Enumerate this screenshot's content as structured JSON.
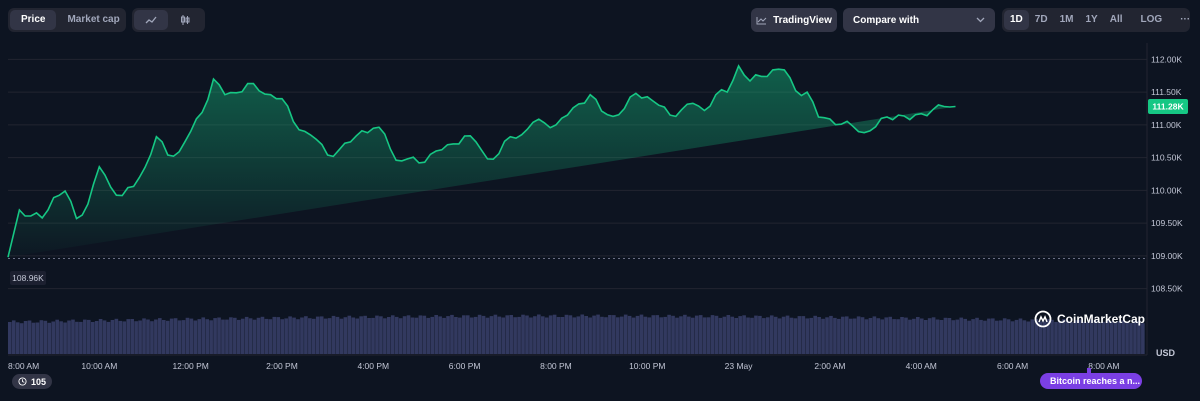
{
  "toolbar": {
    "view_tabs": [
      {
        "label": "Price",
        "active": true
      },
      {
        "label": "Market cap",
        "active": false
      }
    ],
    "chart_type_icons": [
      {
        "icon": "line-chart-icon",
        "active": true
      },
      {
        "icon": "candlestick-icon",
        "active": false
      }
    ],
    "tradingview_label": "TradingView",
    "compare_label": "Compare with",
    "ranges": [
      {
        "label": "1D",
        "active": true
      },
      {
        "label": "7D"
      },
      {
        "label": "1M"
      },
      {
        "label": "1Y"
      },
      {
        "label": "All"
      }
    ],
    "log_label": "LOG",
    "more_label": "···"
  },
  "brand": "CoinMarketCap",
  "events_count": "105",
  "news_pill": "Bitcoin reaches a n...",
  "colors": {
    "background": "#0d1421",
    "line": "#16c784",
    "volume": "#3a3f6a",
    "price_badge": "#16c784"
  },
  "chart_data": {
    "type": "area",
    "ylim": [
      108250,
      112250
    ],
    "y_ticks": [
      "112.00K",
      "111.50K",
      "111.00K",
      "110.50K",
      "110.00K",
      "109.50K",
      "109.00K",
      "108.50K"
    ],
    "y_tick_values": [
      112000,
      111500,
      111000,
      110500,
      110000,
      109500,
      109000,
      108500
    ],
    "currency_label": "USD",
    "x_ticks": [
      "8:00 AM",
      "10:00 AM",
      "12:00 PM",
      "2:00 PM",
      "4:00 PM",
      "6:00 PM",
      "8:00 PM",
      "10:00 PM",
      "23 May",
      "2:00 AM",
      "4:00 AM",
      "6:00 AM",
      "8:00 AM"
    ],
    "x_tick_hours": [
      0,
      2,
      4,
      6,
      8,
      10,
      12,
      14,
      16,
      18,
      20,
      22,
      24
    ],
    "open_price": 108960,
    "open_label": "108.96K",
    "current_price": 111280,
    "current_label": "111.28K",
    "x_hours": [
      0,
      0.25,
      0.5,
      0.75,
      1,
      1.25,
      1.5,
      1.75,
      2,
      2.25,
      2.5,
      2.75,
      3,
      3.25,
      3.5,
      3.75,
      4,
      4.25,
      4.5,
      4.75,
      5,
      5.25,
      5.5,
      5.75,
      6,
      6.25,
      6.5,
      6.75,
      7,
      7.25,
      7.5,
      7.75,
      8,
      8.25,
      8.5,
      8.75,
      9,
      9.25,
      9.5,
      9.75,
      10,
      10.25,
      10.5,
      10.75,
      11,
      11.25,
      11.5,
      11.75,
      12,
      12.25,
      12.5,
      12.75,
      13,
      13.25,
      13.5,
      13.75,
      14,
      14.25,
      14.5,
      14.75,
      15,
      15.25,
      15.5,
      15.75,
      16,
      16.25,
      16.5,
      16.75,
      17,
      17.25,
      17.5,
      17.75,
      18,
      18.25,
      18.5,
      18.75,
      19,
      19.25,
      19.5,
      19.75,
      20,
      20.25,
      20.5,
      20.75,
      21,
      21.25,
      21.5,
      21.75,
      22,
      22.25,
      22.5,
      22.75,
      23,
      23.25,
      23.5,
      23.75,
      24,
      24.25,
      24.5,
      24.75
    ],
    "prices": [
      108980,
      109700,
      109610,
      109580,
      109890,
      109990,
      109570,
      109790,
      110360,
      110050,
      109920,
      110060,
      110350,
      110820,
      110540,
      110590,
      110900,
      111190,
      111700,
      111460,
      111490,
      111630,
      111520,
      111460,
      111400,
      111050,
      110900,
      110780,
      110540,
      110620,
      110740,
      110910,
      110950,
      110860,
      110460,
      110480,
      110420,
      110550,
      110620,
      110710,
      110830,
      110740,
      110480,
      110560,
      110820,
      110850,
      111040,
      111030,
      111000,
      111150,
      111320,
      111460,
      111210,
      111130,
      111250,
      111480,
      111430,
      111300,
      111150,
      111230,
      111330,
      111220,
      111460,
      111500,
      111900,
      111670,
      111740,
      111840,
      111840,
      111520,
      111500,
      111120,
      111090,
      111010,
      110980,
      110880,
      110970,
      111120,
      111150,
      111080,
      111170,
      111230,
      111280,
      111280
    ],
    "volume_note": "relative"
  }
}
